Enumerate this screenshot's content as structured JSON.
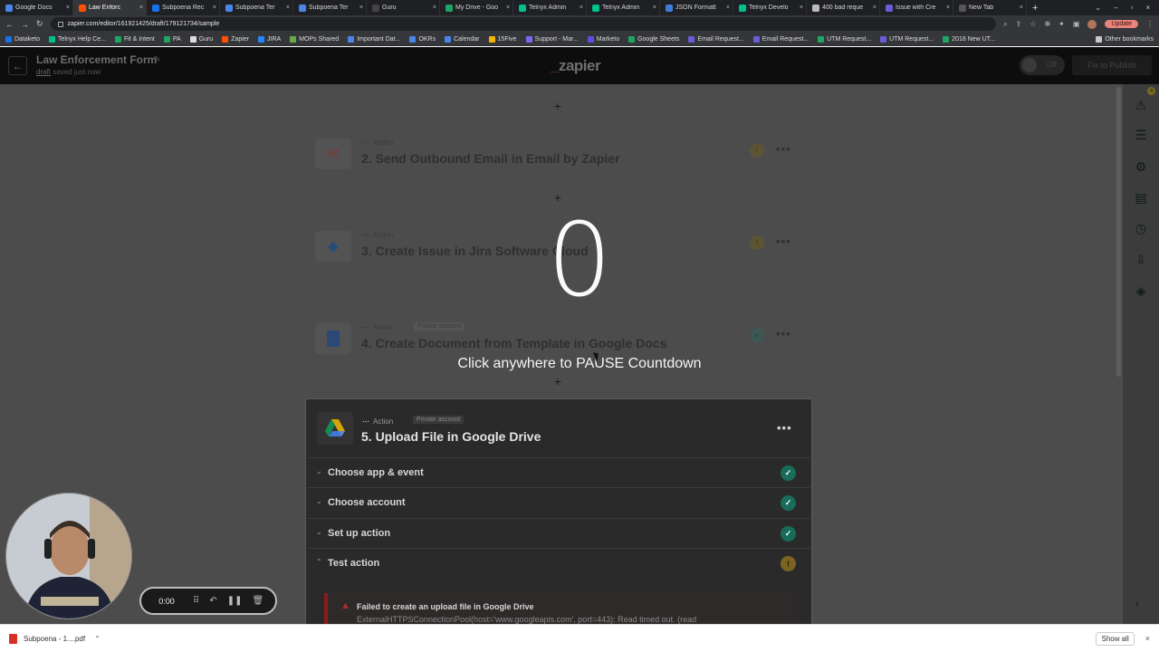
{
  "browser": {
    "tabs": [
      {
        "title": "Google Docs",
        "color": "#4a86e8",
        "active": false
      },
      {
        "title": "Law Enforc",
        "color": "#ff4f00",
        "active": true
      },
      {
        "title": "Subpoena Rec",
        "color": "#1a73e8",
        "active": false
      },
      {
        "title": "Subpoena Ter",
        "color": "#4a86e8",
        "active": false
      },
      {
        "title": "Subpoena Ter",
        "color": "#4a86e8",
        "active": false
      },
      {
        "title": "Guru",
        "color": "#444444",
        "active": false
      },
      {
        "title": "My Drive - Goo",
        "color": "#1fa463",
        "active": false
      },
      {
        "title": "Telnyx Admin",
        "color": "#00c08b",
        "active": false
      },
      {
        "title": "Telnyx Admin",
        "color": "#00c08b",
        "active": false
      },
      {
        "title": "JSON Formatt",
        "color": "#3d7dd8",
        "active": false
      },
      {
        "title": "Telnyx Develo",
        "color": "#00c08b",
        "active": false
      },
      {
        "title": "400 bad reque",
        "color": "#bbbbbb",
        "active": false
      },
      {
        "title": "Issue with Cre",
        "color": "#6b5bd6",
        "active": false
      },
      {
        "title": "New Tab",
        "color": "#555555",
        "active": false
      }
    ],
    "url": "zapier.com/editor/161921425/draft/179121734/sample",
    "update_label": "Update",
    "bookmarks": [
      {
        "label": "Dataketo",
        "color": "#1a73e8"
      },
      {
        "label": "Telnyx Help Ce...",
        "color": "#00c08b"
      },
      {
        "label": "Fit & Intent",
        "color": "#1fa463"
      },
      {
        "label": "PA",
        "color": "#1fa463"
      },
      {
        "label": "Guru",
        "color": "#dddddd"
      },
      {
        "label": "Zapier",
        "color": "#ff4f00"
      },
      {
        "label": "JIRA",
        "color": "#2684ff"
      },
      {
        "label": "MOPs Shared",
        "color": "#6aa84f"
      },
      {
        "label": "Important Dat...",
        "color": "#4a86e8"
      },
      {
        "label": "OKRs",
        "color": "#4a86e8"
      },
      {
        "label": "Calendar",
        "color": "#4a86e8"
      },
      {
        "label": "15Five",
        "color": "#f4b400"
      },
      {
        "label": "Support - Mar...",
        "color": "#7b68ee"
      },
      {
        "label": "Marketo",
        "color": "#5c4ee5"
      },
      {
        "label": "Google Sheets",
        "color": "#1fa463"
      },
      {
        "label": "Email Request...",
        "color": "#6b5bd6"
      },
      {
        "label": "Email Request...",
        "color": "#6b5bd6"
      },
      {
        "label": "UTM Request...",
        "color": "#1fa463"
      },
      {
        "label": "UTM Request...",
        "color": "#6b5bd6"
      },
      {
        "label": "2018 New UT...",
        "color": "#1fa463"
      }
    ],
    "other_bookmarks": "Other bookmarks"
  },
  "zap": {
    "title": "Law Enforcement Form",
    "draft_word": "draft",
    "saved_text": "saved just now",
    "logo": "zapier",
    "toggle_label": "Off",
    "fix_button": "Fix to Publish",
    "alert_count": "4"
  },
  "steps": [
    {
      "kind": "Action",
      "title": "2. Send Outbound Email in Email by Zapier",
      "icon": "envelope-icon",
      "status": "warning",
      "private": ""
    },
    {
      "kind": "Action",
      "title": "3. Create Issue in Jira Software Cloud",
      "icon": "jira-icon",
      "status": "warning",
      "private": ""
    },
    {
      "kind": "Action",
      "title": "4. Create Document from Template in Google Docs",
      "icon": "google-docs-icon",
      "status": "ok",
      "private": "Private account"
    }
  ],
  "active_step": {
    "kind": "Action",
    "private": "Private account",
    "title": "5. Upload File in Google Drive",
    "sections": [
      {
        "label": "Choose app & event",
        "status": "ok"
      },
      {
        "label": "Choose account",
        "status": "ok"
      },
      {
        "label": "Set up action",
        "status": "ok"
      },
      {
        "label": "Test action",
        "status": "warning"
      }
    ],
    "error_title": "Failed to create an upload file in Google Drive",
    "error_message": "ExternalHTTPSConnectionPool(host='www.googleapis.com', port=443): Read timed out. (read"
  },
  "overlay": {
    "countdown": "0",
    "hint": "Click anywhere to PAUSE Countdown"
  },
  "recorder": {
    "time": "0:00"
  },
  "download": {
    "file": "Subpoena - 1....pdf",
    "show_all": "Show all"
  }
}
